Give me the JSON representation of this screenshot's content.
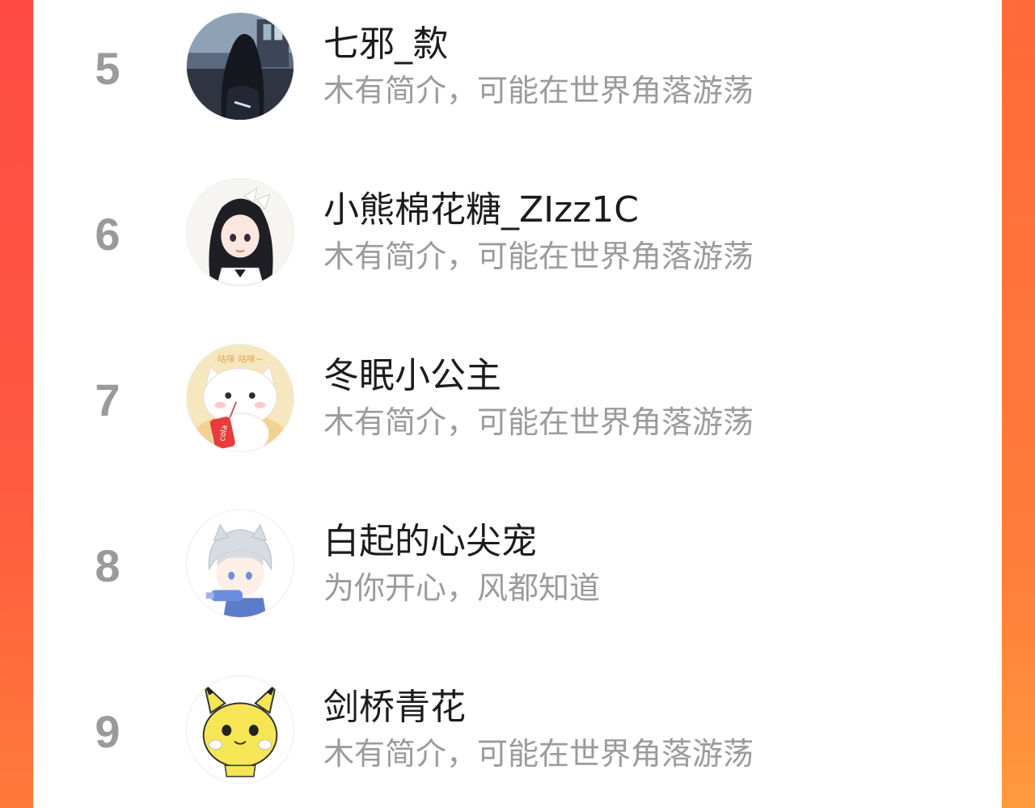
{
  "ranking": {
    "items": [
      {
        "rank": "5",
        "name": "七邪_歀",
        "bio": "木有简介，可能在世界角落游荡",
        "avatar_icon": "girl-photo-avatar"
      },
      {
        "rank": "6",
        "name": "小熊棉花糖_ZIzz1C",
        "bio": "木有简介，可能在世界角落游荡",
        "avatar_icon": "anime-maid-girl-avatar"
      },
      {
        "rank": "7",
        "name": "冬眠小公主",
        "bio": "木有简介，可能在世界角落游荡",
        "avatar_icon": "white-cat-cola-avatar",
        "avatar_text": "咕咪 咕咪~",
        "cola_label": "cola"
      },
      {
        "rank": "8",
        "name": "白起的心尖宠",
        "bio": "为你开心，风都知道",
        "avatar_icon": "silver-hair-boy-avatar"
      },
      {
        "rank": "9",
        "name": "剑桥青花",
        "bio": "木有简介，可能在世界角落游荡",
        "avatar_icon": "pikachu-avatar"
      }
    ]
  },
  "colors": {
    "background_red": "#ff4a45",
    "background_orange": "#ff7d3a",
    "rank_gray": "#9a9a9a",
    "name_black": "#1c1c1c",
    "bio_gray": "#9b9b9b"
  }
}
